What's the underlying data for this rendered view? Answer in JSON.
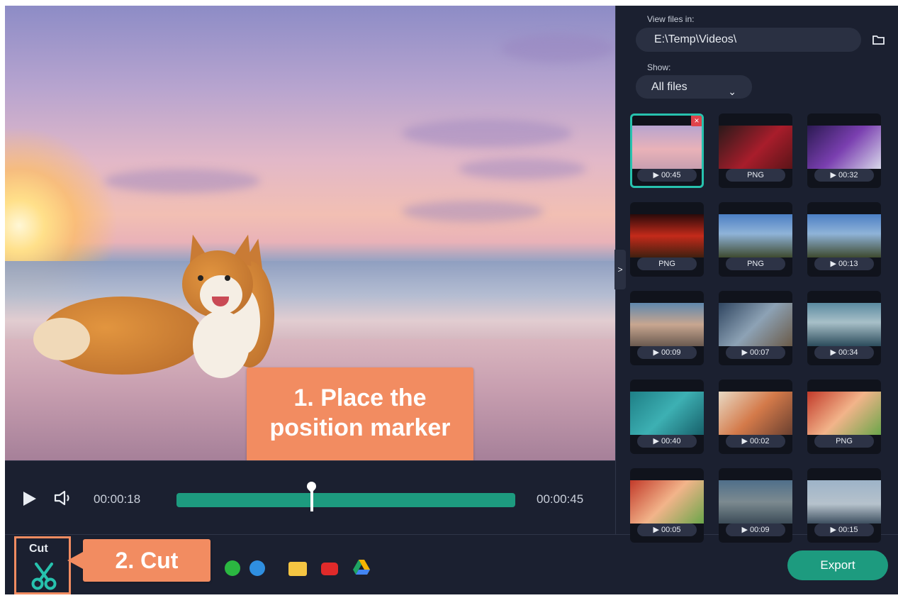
{
  "tooltips": {
    "step1": "1. Place the position marker",
    "step2": "2. Cut"
  },
  "player": {
    "current_time": "00:00:18",
    "total_time": "00:00:45",
    "progress_fraction": 0.4
  },
  "bottom": {
    "cut_label": "Cut",
    "export_label": "Export",
    "share_services": [
      "whatsapp-icon",
      "telegram-icon",
      "email-icon",
      "youtube-icon",
      "google-drive-icon"
    ]
  },
  "panel": {
    "view_files_label": "View files in:",
    "path": "E:\\Temp\\Videos\\",
    "show_label": "Show:",
    "show_value": "All files"
  },
  "files": [
    {
      "label": "▶ 00:45"
    },
    {
      "label": "PNG"
    },
    {
      "label": "▶ 00:32"
    },
    {
      "label": "PNG"
    },
    {
      "label": "PNG"
    },
    {
      "label": "▶ 00:13"
    },
    {
      "label": "▶ 00:09"
    },
    {
      "label": "▶ 00:07"
    },
    {
      "label": "▶ 00:34"
    },
    {
      "label": "▶ 00:40"
    },
    {
      "label": "▶ 00:02"
    },
    {
      "label": "PNG"
    },
    {
      "label": "▶ 00:05"
    },
    {
      "label": "▶ 00:09"
    },
    {
      "label": "▶ 00:15"
    }
  ],
  "colors": {
    "accent": "#1d9b7f",
    "tooltip": "#f28c61",
    "background": "#1b2030"
  }
}
